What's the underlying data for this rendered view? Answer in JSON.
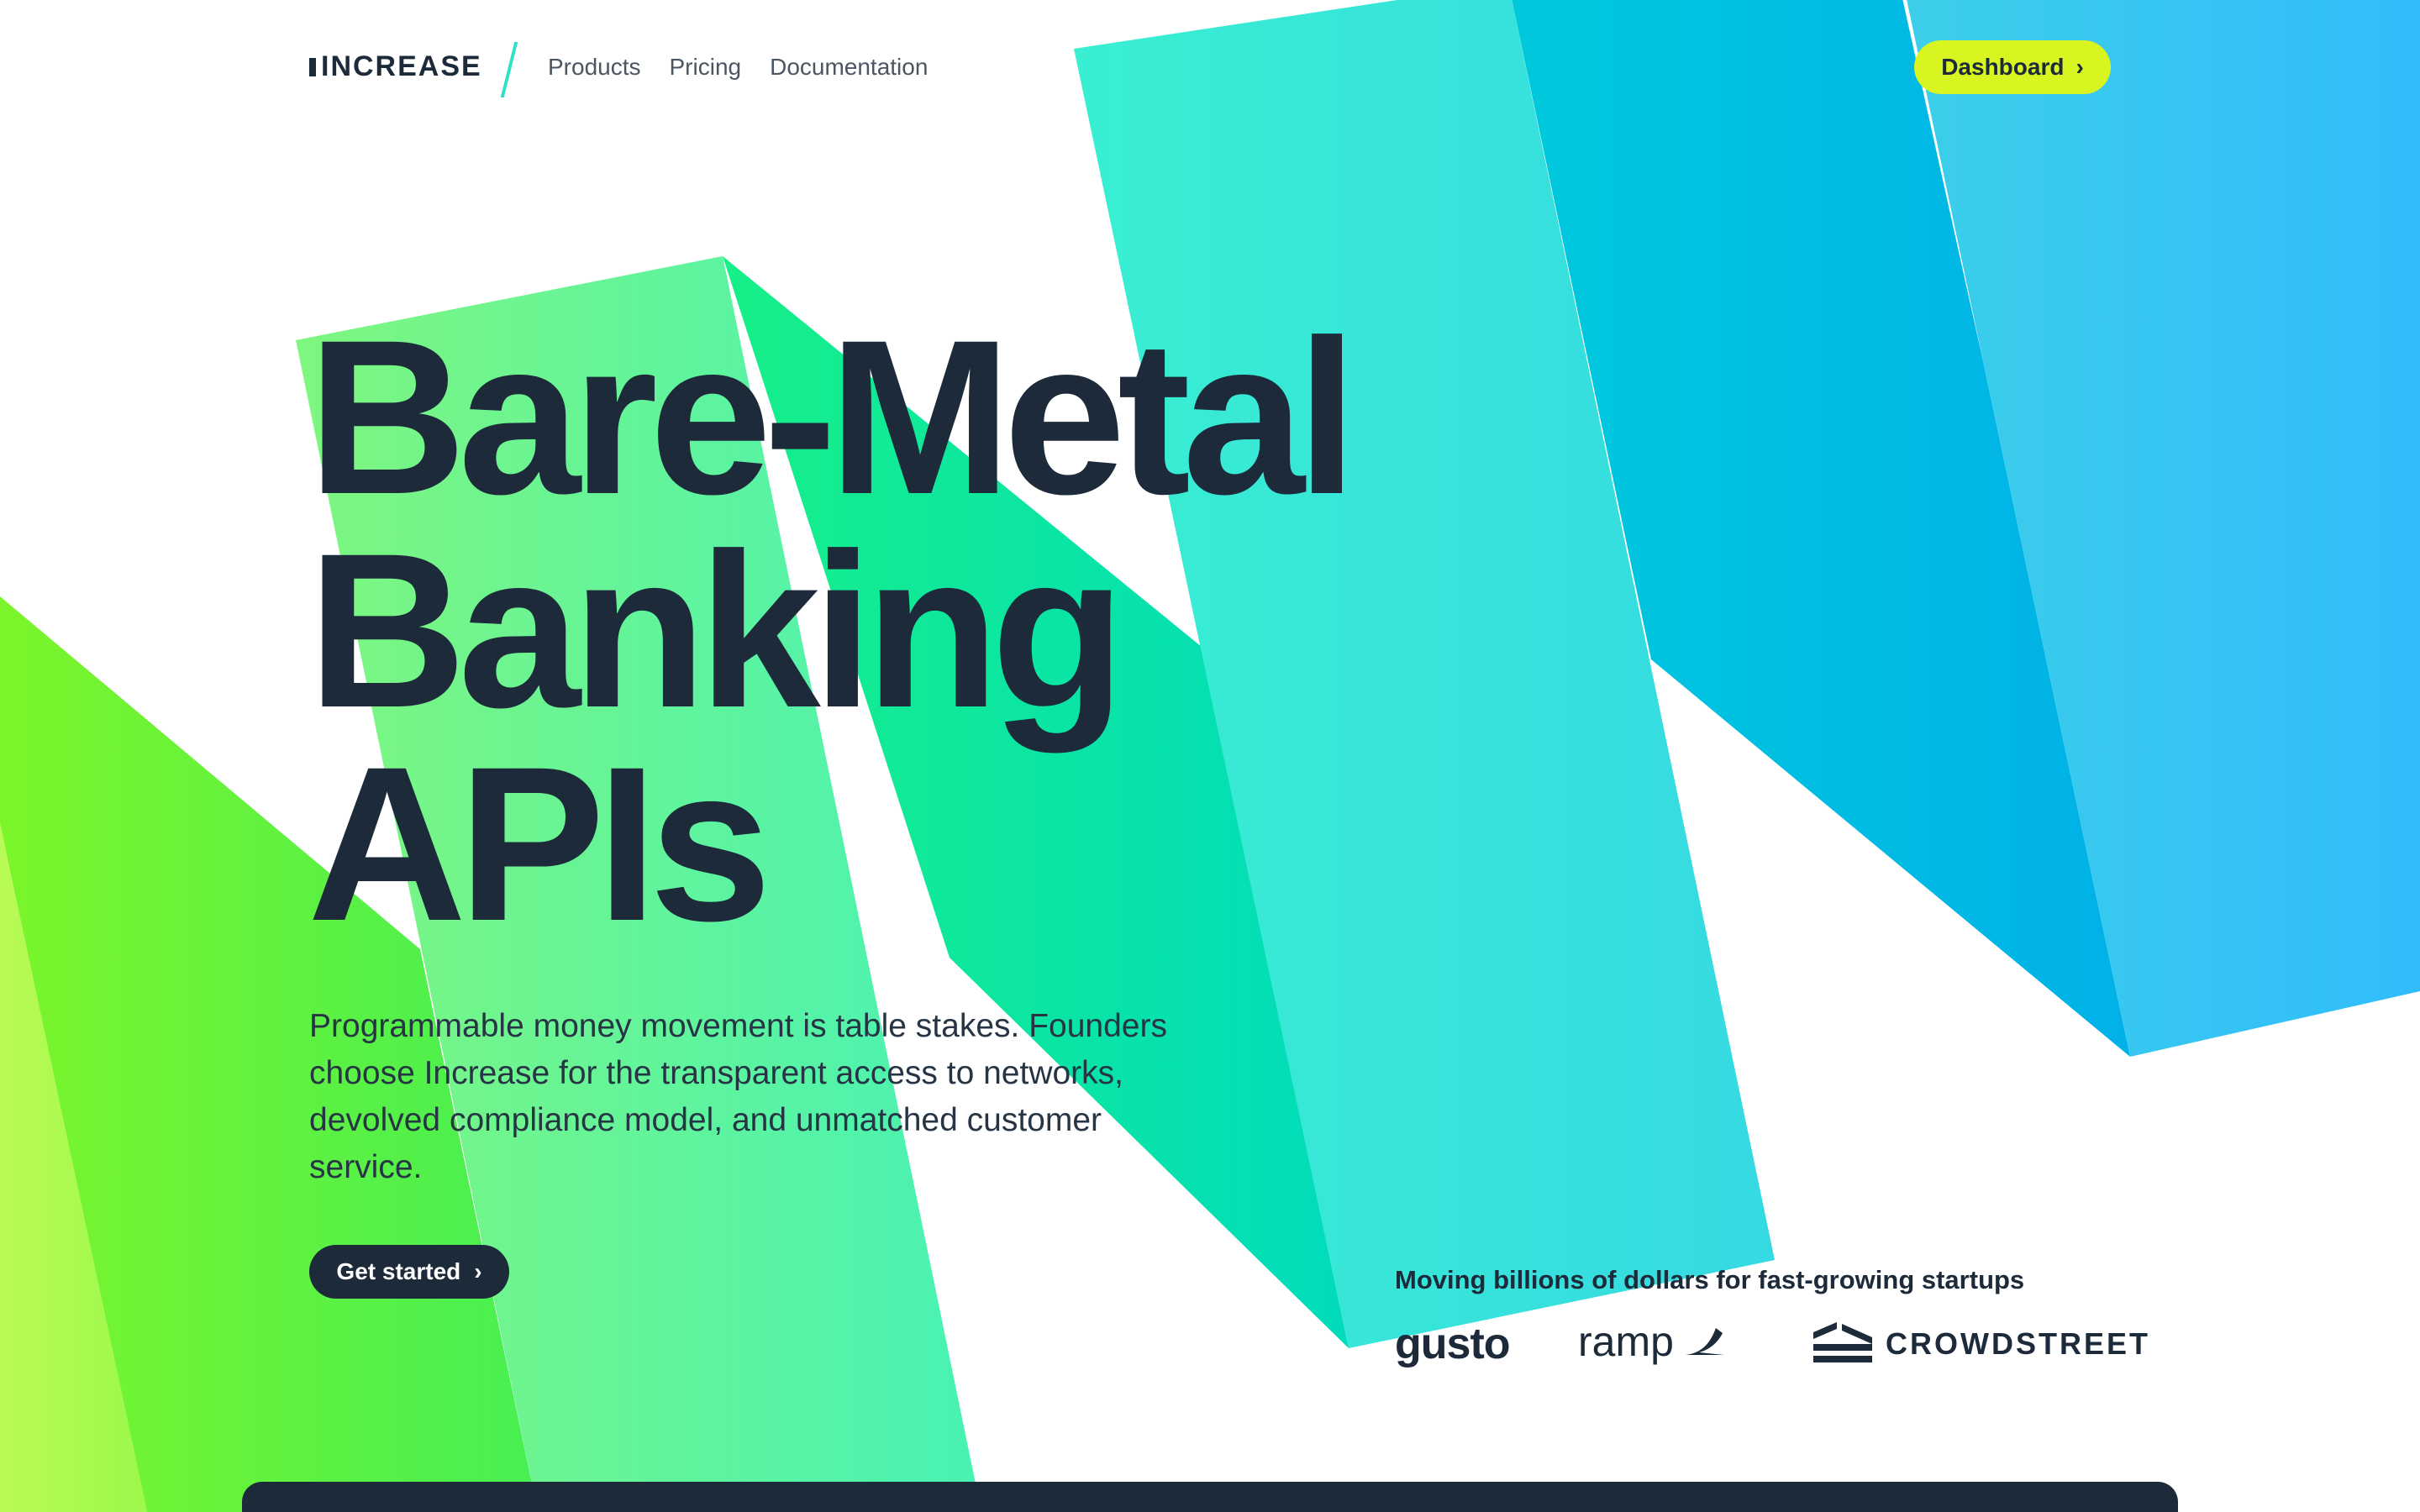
{
  "brand": {
    "logo_text": "INCREASE"
  },
  "nav": {
    "links": [
      "Products",
      "Pricing",
      "Documentation"
    ],
    "dashboard_label": "Dashboard"
  },
  "hero": {
    "title_lines": [
      "Bare-Metal",
      "Banking",
      "APIs"
    ],
    "description": "Programmable money movement is table stakes. Founders choose Increase for the transparent access to networks, devolved compliance model, and unmatched customer service.",
    "cta_label": "Get started"
  },
  "trust": {
    "label": "Moving billions of dollars for fast-growing startups",
    "logos": [
      "gusto",
      "ramp",
      "CROWDSTREET"
    ]
  },
  "colors": {
    "text_dark": "#1c2a3a",
    "accent_lime": "#d8f521",
    "green": "#5ef54a",
    "teal": "#2fe3d6",
    "blue": "#2bb8f5"
  },
  "icons": {
    "chevron": "chevron-right-icon",
    "ramp_mark": "ramp-wing-icon",
    "crowdstreet_mark": "crowdstreet-stack-icon"
  }
}
